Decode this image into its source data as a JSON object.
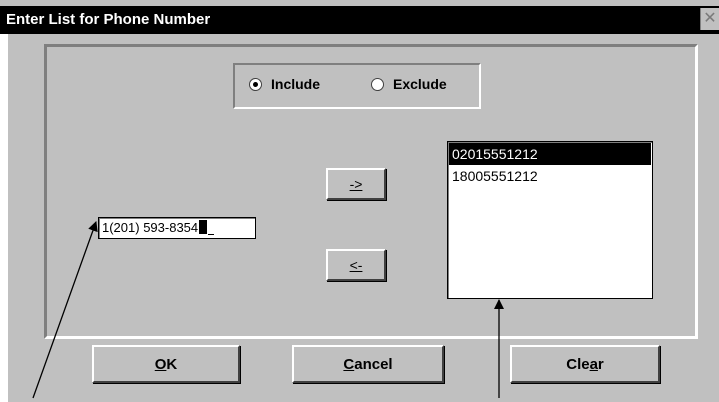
{
  "window": {
    "title": "Enter List for Phone Number",
    "close_glyph": "✕"
  },
  "mode": {
    "options": [
      {
        "label": "Include",
        "checked": true
      },
      {
        "label": "Exclude",
        "checked": false
      }
    ]
  },
  "phone_input": {
    "value": "1(201) 593-8354"
  },
  "transfer": {
    "add_label": "->",
    "remove_label": "<-"
  },
  "number_list": {
    "items": [
      "02015551212",
      "18005551212"
    ],
    "selected_index": 0
  },
  "buttons": {
    "ok": {
      "underlined": "O",
      "rest": "K"
    },
    "cancel": {
      "underlined": "C",
      "rest": "ancel"
    },
    "clear": {
      "before": "Cle",
      "underlined": "a",
      "after": "r"
    }
  },
  "colors": {
    "titlebar": "#000000",
    "face": "#c0c0c0",
    "selection": "#000000"
  }
}
